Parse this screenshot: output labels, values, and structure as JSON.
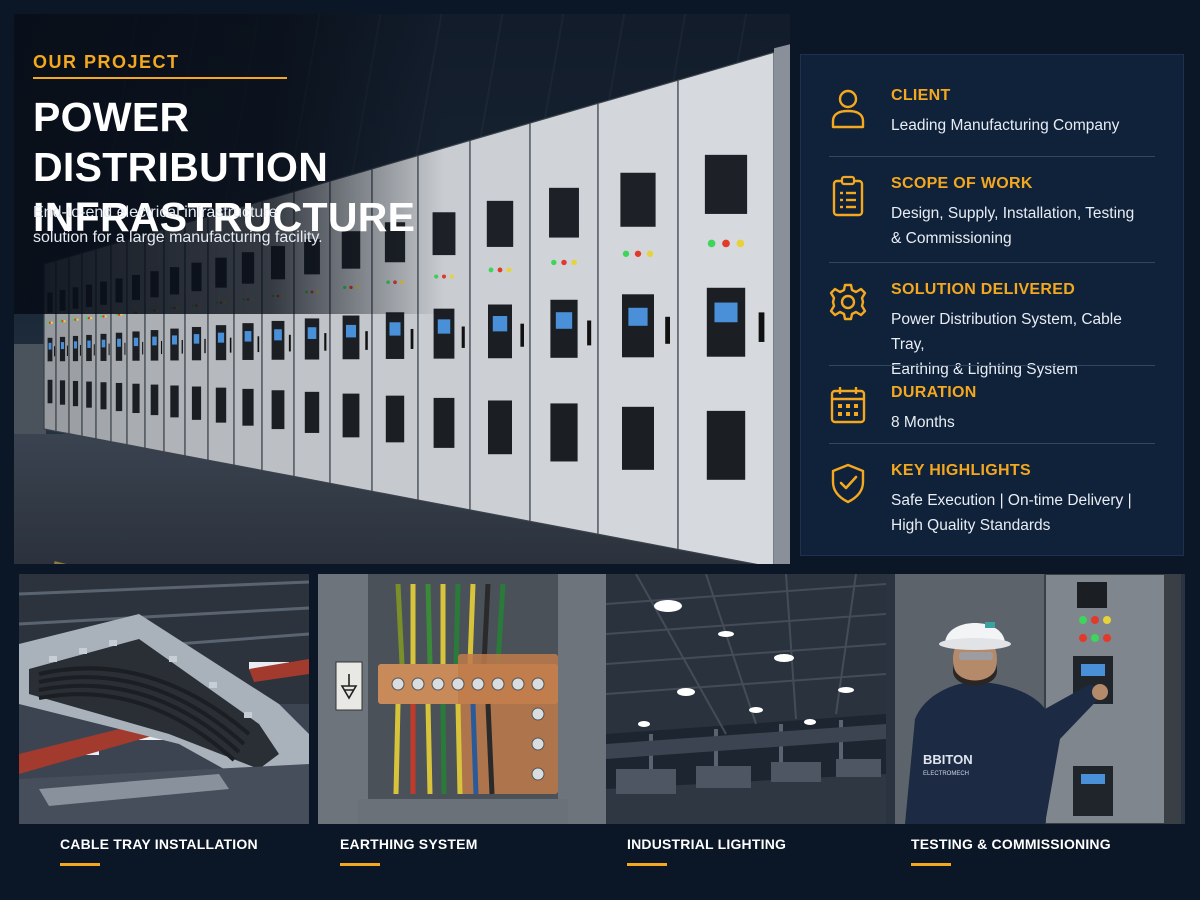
{
  "hero": {
    "eyebrow": "OUR PROJECT",
    "title": "POWER DISTRIBUTION\nINFRASTRUCTURE",
    "description": "End-to-end electrical infrastructure\nsolution for a large manufacturing facility."
  },
  "details": [
    {
      "icon": "user-icon",
      "label": "CLIENT",
      "value": "Leading Manufacturing Company"
    },
    {
      "icon": "clipboard-icon",
      "label": "SCOPE OF WORK",
      "value": "Design, Supply, Installation, Testing\n& Commissioning"
    },
    {
      "icon": "gear-icon",
      "label": "SOLUTION DELIVERED",
      "value": "Power Distribution System, Cable Tray,\nEarthing & Lighting System"
    },
    {
      "icon": "calendar-icon",
      "label": "DURATION",
      "value": "8 Months"
    },
    {
      "icon": "shield-check-icon",
      "label": "KEY HIGHLIGHTS",
      "value": "Safe Execution | On-time Delivery |\nHigh Quality Standards"
    }
  ],
  "gallery": [
    {
      "label": "CABLE TRAY INSTALLATION"
    },
    {
      "label": "EARTHING SYSTEM"
    },
    {
      "label": "INDUSTRIAL LIGHTING"
    },
    {
      "label": "TESTING & COMMISSIONING"
    }
  ],
  "branding": {
    "jacket_logo_line1": "BBITON",
    "jacket_logo_line2": "ELECTROMECH"
  },
  "colors": {
    "background": "#0b1626",
    "accent": "#f3a81f",
    "panel": "#10213a"
  }
}
